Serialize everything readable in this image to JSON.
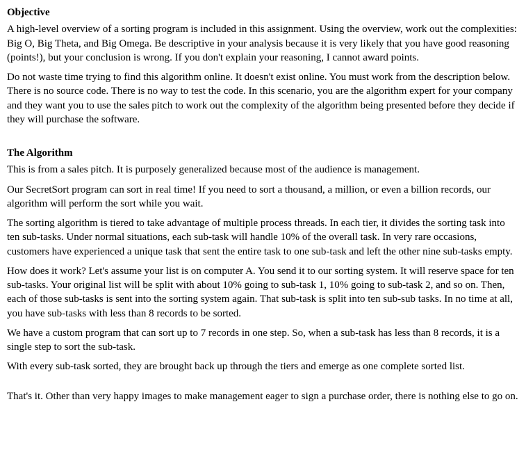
{
  "objective": {
    "heading": "Objective",
    "p1": "A high-level overview of a sorting program is included in this assignment. Using the overview, work out the complexities: Big O, Big Theta, and Big Omega. Be descriptive in your analysis because it is very likely that you have good reasoning (points!), but your conclusion is wrong. If you don't explain your reasoning, I cannot award points.",
    "p2": "Do not waste time trying to find this algorithm online. It doesn't exist online. You must work from the description below. There is no source code. There is no way to test the code. In this scenario, you are the algorithm expert for your company and they want you to use the sales pitch to work out the complexity of the algorithm being presented before they decide if they will purchase the software."
  },
  "algorithm": {
    "heading": "The Algorithm",
    "p1": "This is from a sales pitch. It is purposely generalized because most of the audience is management.",
    "p2": "Our SecretSort program can sort in real time! If you need to sort a thousand, a million, or even a billion records, our algorithm will perform the sort while you wait.",
    "p3": "The sorting algorithm is tiered to take advantage of multiple process threads. In each tier, it divides the sorting task into ten sub-tasks. Under normal situations, each sub-task will handle 10% of the overall task. In very rare occasions, customers have experienced a unique task that sent the entire task to one sub-task and left the other nine sub-tasks empty.",
    "p4": "How does it work? Let's assume your list is on computer A. You send it to our sorting system. It will reserve space for ten sub-tasks. Your original list will be split with about 10% going to sub-task 1, 10% going to sub-task 2, and so on. Then, each of those sub-tasks is sent into the sorting system again. That sub-task is split into ten sub-sub tasks. In no time at all, you have sub-tasks with less than 8 records to be sorted.",
    "p5": "We have a custom program that can sort up to 7 records in one step. So, when a sub-task has less than 8 records, it is a single step to sort the sub-task.",
    "p6": "With every sub-task sorted, they are brought back up through the tiers and emerge as one complete sorted list."
  },
  "closing": {
    "p1": "That's it. Other than very happy images to make management eager to sign a purchase order, there is nothing else to go on."
  }
}
